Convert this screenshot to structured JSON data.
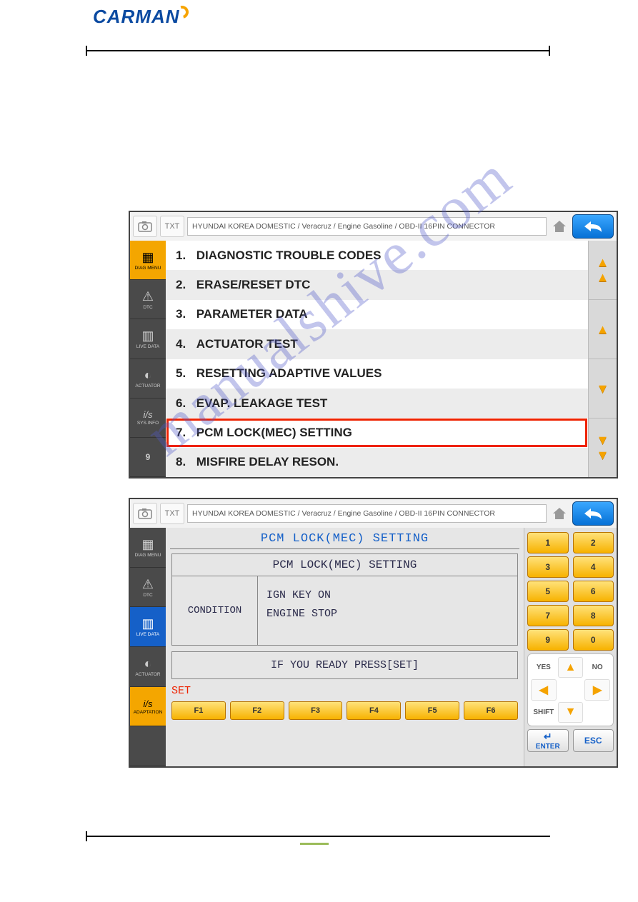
{
  "logo_text": "CARMAN",
  "watermark": "manualshive.com",
  "path_text": "HYUNDAI KOREA DOMESTIC / Veracruz / Engine Gasoline / OBD-II 16PIN CONNECTOR",
  "sidebar1": [
    {
      "label": "DIAG MENU",
      "icon": "▦"
    },
    {
      "label": "DTC",
      "icon": "⚠"
    },
    {
      "label": "LIVE DATA",
      "icon": "▥"
    },
    {
      "label": "ACTUATOR",
      "icon": "◑"
    },
    {
      "label": "SYS.INFO",
      "icon": "i/s"
    },
    {
      "label": "9",
      "icon": ""
    }
  ],
  "sidebar2": [
    {
      "label": "DIAG MENU",
      "icon": "▦"
    },
    {
      "label": "DTC",
      "icon": "⚠"
    },
    {
      "label": "LIVE DATA",
      "icon": "▥"
    },
    {
      "label": "ACTUATOR",
      "icon": "◑"
    },
    {
      "label": "ADAPTATION",
      "icon": "i/s"
    },
    {
      "label": "",
      "icon": ""
    }
  ],
  "menu": [
    {
      "n": "1.",
      "t": "DIAGNOSTIC TROUBLE CODES"
    },
    {
      "n": "2.",
      "t": "ERASE/RESET DTC"
    },
    {
      "n": "3.",
      "t": "PARAMETER DATA"
    },
    {
      "n": "4.",
      "t": "ACTUATOR TEST"
    },
    {
      "n": "5.",
      "t": "RESETTING ADAPTIVE VALUES"
    },
    {
      "n": "6.",
      "t": "EVAP. LEAKAGE TEST"
    },
    {
      "n": "7.",
      "t": "PCM LOCK(MEC) SETTING"
    },
    {
      "n": "8.",
      "t": "MISFIRE DELAY RESON."
    }
  ],
  "highlight_index": 6,
  "title2": "PCM LOCK(MEC) SETTING",
  "panel_head": "PCM LOCK(MEC) SETTING",
  "condition_label": "CONDITION",
  "condition_line1": "IGN KEY ON",
  "condition_line2": "ENGINE STOP",
  "prompt": "IF YOU READY PRESS[SET]",
  "set_label": "SET",
  "fkeys": [
    "F1",
    "F2",
    "F3",
    "F4",
    "F5",
    "F6"
  ],
  "numpad": [
    "1",
    "2",
    "3",
    "4",
    "5",
    "6",
    "7",
    "8",
    "9",
    "0"
  ],
  "dpad": {
    "yes": "YES",
    "no": "NO",
    "shift": "SHIFT"
  },
  "enter": "ENTER",
  "esc": "ESC",
  "txt_icon": "TXT"
}
